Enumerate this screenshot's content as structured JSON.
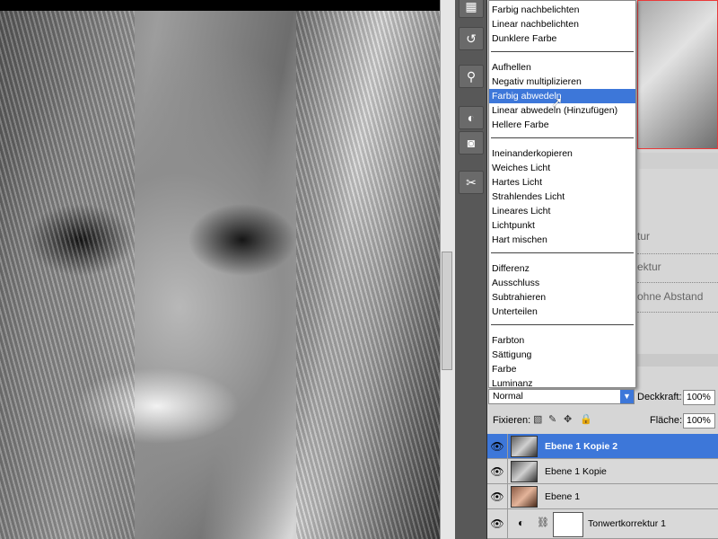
{
  "blend_menu": {
    "groups": [
      {
        "items": [
          "Farbig nachbelichten",
          "Linear nachbelichten",
          "Dunklere Farbe"
        ]
      },
      {
        "items": [
          "Aufhellen",
          "Negativ multiplizieren",
          "Farbig abwedeln",
          "Linear abwedeln (Hinzufügen)",
          "Hellere Farbe"
        ]
      },
      {
        "items": [
          "Ineinanderkopieren",
          "Weiches Licht",
          "Hartes Licht",
          "Strahlendes Licht",
          "Lineares Licht",
          "Lichtpunkt",
          "Hart mischen"
        ]
      },
      {
        "items": [
          "Differenz",
          "Ausschluss",
          "Subtrahieren",
          "Unterteilen"
        ]
      },
      {
        "items": [
          "Farbton",
          "Sättigung",
          "Farbe",
          "Luminanz"
        ]
      }
    ],
    "selected": "Farbig abwedeln"
  },
  "panel_fragments": [
    "tur",
    "ektur",
    "ohne Abstand"
  ],
  "layers_panel": {
    "blend_mode": "Normal",
    "opacity_label": "Deckkraft:",
    "opacity_value": "100%",
    "lock_label": "Fixieren:",
    "fill_label": "Fläche:",
    "fill_value": "100%",
    "layers": [
      {
        "name": "Ebene 1 Kopie 2",
        "active": true,
        "thumb": "bw"
      },
      {
        "name": "Ebene 1 Kopie",
        "active": false,
        "thumb": "bw"
      },
      {
        "name": "Ebene 1",
        "active": false,
        "thumb": "color"
      },
      {
        "name": "Tonwertkorrektur 1",
        "active": false,
        "thumb": "adjustment"
      }
    ]
  },
  "colors": {
    "selection": "#3d77d9",
    "nav_border": "#ea3a3a"
  }
}
